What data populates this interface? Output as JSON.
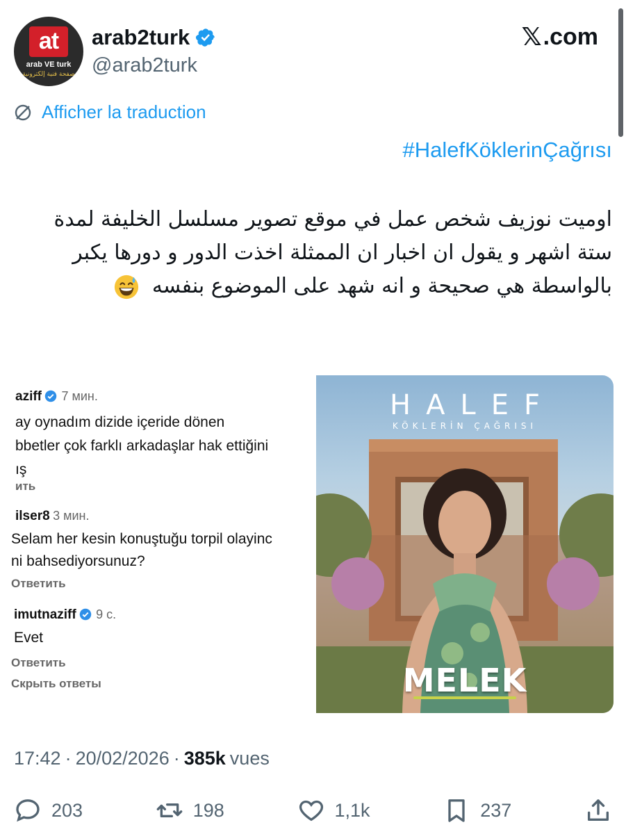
{
  "header": {
    "display_name": "arab2turk",
    "handle": "@arab2turk",
    "site": ".com",
    "site_mark": "𝕏",
    "avatar": {
      "letters": "at",
      "name": "arab VE turk",
      "tagline": "صفحة فنية إلكترونية"
    },
    "verified_icon": "verified-badge-icon"
  },
  "translate": {
    "label": "Afficher la traduction",
    "icon": "translate-icon"
  },
  "tweet": {
    "hashtag": "#HalefKöklerinÇağrısı",
    "text": "اوميت نوزيف شخص عمل في موقع تصوير مسلسل الخليفة لمدة ستة اشهر و يقول ان اخبار ان الممثلة اخذت الدور و دورها يكبر بالواسطة هي صحيحة و انه شهد على الموضوع بنفسه",
    "emoji": "grinning-sweat-emoji"
  },
  "media": {
    "comments": {
      "c1_user": "aziff",
      "c1_time": "7 мин.",
      "c1_line1": "ay oynadım dizide içeride dönen",
      "c1_line2": "bbetler çok farklı arkadaşlar hak ettiğini",
      "c1_line3": "ış",
      "c1_reply": "ить",
      "c2_user": "ilser8",
      "c2_time": "3 мин.",
      "c2_line1": "Selam her kesin konuştuğu torpil olayinc",
      "c2_line2": "ni bahsediyorsunuz?",
      "c2_reply": "Ответить",
      "c3_user": "imutnaziff",
      "c3_time": "9 с.",
      "c3_line1": "Evet",
      "c3_reply": "Ответить",
      "c3_hide": "Скрыть ответы"
    },
    "poster": {
      "title": "HALEF",
      "subtitle": "KÖKLERİN ÇAĞRISI",
      "name": "MELEK"
    }
  },
  "meta": {
    "time": "17:42",
    "separator": "·",
    "date": "20/02/2026",
    "views_count": "385k",
    "views_label": "vues"
  },
  "actions": {
    "replies": "203",
    "reposts": "198",
    "likes": "1,1k",
    "bookmarks": "237"
  },
  "colors": {
    "link": "#1d9bf0",
    "secondary_text": "#536471",
    "primary_text": "#0f1419",
    "avatar_red": "#d3202a"
  }
}
